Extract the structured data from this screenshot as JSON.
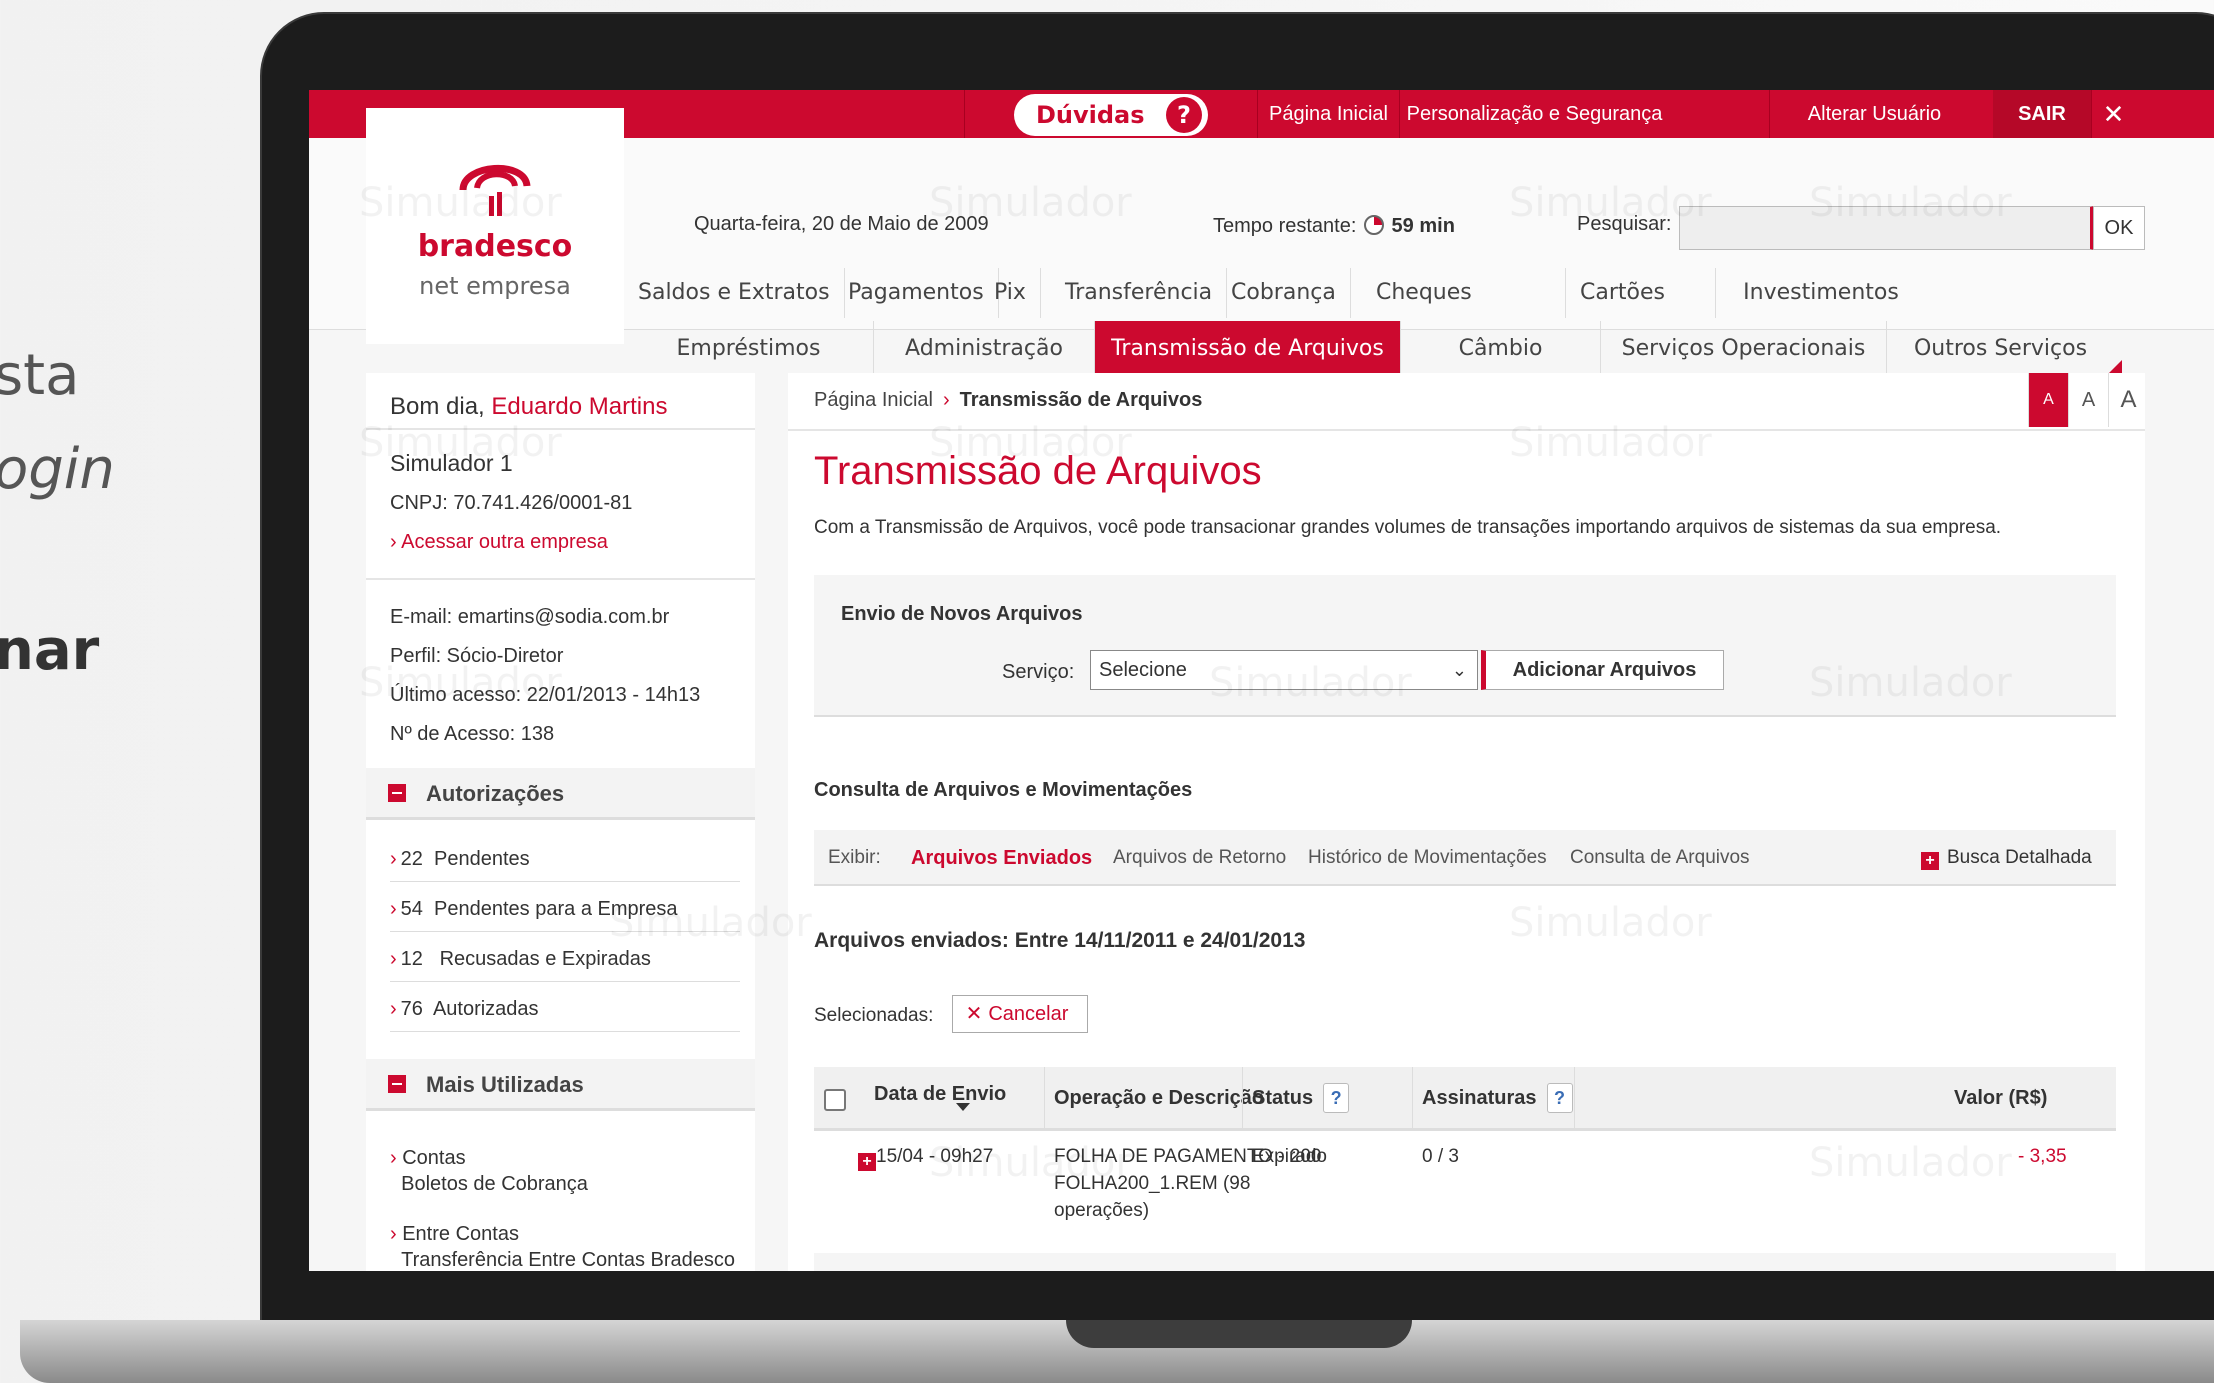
{
  "side": {
    "line1": "sta",
    "line2": "ogin",
    "line3": "nar"
  },
  "topbar": {
    "duvidas": "Dúvidas",
    "duvidas_q": "?",
    "pagina_inicial": "Página Inicial",
    "personalizacao": "Personalização e Segurança",
    "alterar_usuario": "Alterar Usuário",
    "sair": "SAIR",
    "close": "✕"
  },
  "header": {
    "logo_brand": "bradesco",
    "logo_product": "net empresa",
    "date": "Quarta-feira, 20 de Maio de 2009",
    "time_label": "Tempo restante:",
    "time_value": "59 min",
    "search_label": "Pesquisar:",
    "search_ok": "OK"
  },
  "nav1": [
    "Saldos e Extratos",
    "Pagamentos",
    "Pix",
    "Transferência",
    "Cobrança",
    "Cheques",
    "Cartões",
    "Investimentos"
  ],
  "nav2": [
    "Empréstimos",
    "Administração",
    "Transmissão de Arquivos",
    "Câmbio",
    "Serviços Operacionais",
    "Outros Serviços"
  ],
  "user": {
    "greeting": "Bom dia,",
    "name": "Eduardo Martins",
    "company": "Simulador 1",
    "cnpj": "CNPJ: 70.741.426/0001-81",
    "other_company": "Acessar outra empresa",
    "email": "E-mail: emartins@sodia.com.br",
    "perfil": "Perfil: Sócio-Diretor",
    "last_access": "Último acesso: 22/01/2013 - 14h13",
    "access_count": "Nº de Acesso: 138"
  },
  "autorizacoes": {
    "title": "Autorizações",
    "items": [
      {
        "count": "22",
        "label": "Pendentes"
      },
      {
        "count": "54",
        "label": "Pendentes para a Empresa"
      },
      {
        "count": "12",
        "label": "Recusadas e Expiradas"
      },
      {
        "count": "76",
        "label": "Autorizadas"
      }
    ]
  },
  "mais_utilizadas": {
    "title": "Mais Utilizadas",
    "items": [
      {
        "label": "Contas",
        "sub": "Boletos de Cobrança"
      },
      {
        "label": "Entre Contas",
        "sub": "Transferência Entre Contas Bradesco"
      }
    ]
  },
  "main": {
    "breadcrumb_home": "Página Inicial",
    "breadcrumb_sep": "›",
    "breadcrumb_current": "Transmissão de Arquivos",
    "font_sizes": [
      "A",
      "A",
      "A"
    ],
    "title": "Transmissão de Arquivos",
    "description": "Com a Transmissão de Arquivos, você pode transacionar grandes volumes de transações importando arquivos de sistemas da sua empresa.",
    "envio_title": "Envio de Novos Arquivos",
    "servico_label": "Serviço:",
    "servico_value": "Selecione",
    "add_button": "Adicionar Arquivos",
    "consulta_title": "Consulta de Arquivos e Movimentações",
    "exibir_label": "Exibir:",
    "exibir_tabs": [
      "Arquivos Enviados",
      "Arquivos de Retorno",
      "Histórico de Movimentações",
      "Consulta de Arquivos"
    ],
    "busca": "Busca Detalhada",
    "range": "Arquivos enviados: Entre 14/11/2011 e 24/01/2013",
    "selecionadas": "Selecionadas:",
    "cancelar": "Cancelar"
  },
  "table": {
    "headers": [
      "Data de Envio",
      "Operação e Descrição",
      "Status",
      "Assinaturas",
      "Valor (R$)"
    ],
    "rows": [
      {
        "date": "15/04 - 09h27",
        "op1": "FOLHA DE PAGAMENTO - 200",
        "op2": "FOLHA200_1.REM (98",
        "op3": "operações)",
        "status": "Expirado",
        "sig": "0 / 3",
        "value": "- 3,35"
      }
    ]
  },
  "watermark": "Simulador",
  "colors": {
    "brand": "#cc092f"
  }
}
